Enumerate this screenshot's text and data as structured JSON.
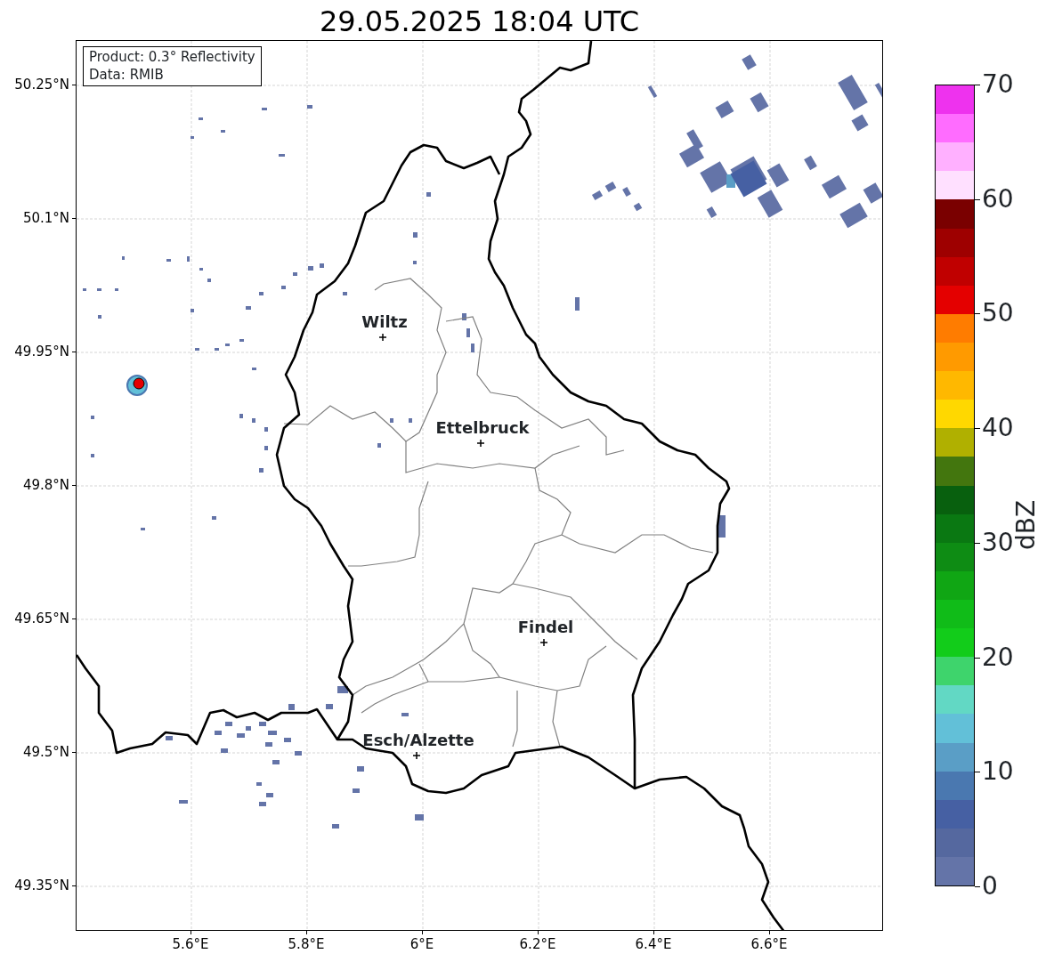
{
  "title": "29.05.2025 18:04 UTC",
  "info_box": [
    "Product: 0.3° Reflectivity",
    "Data: RMIB"
  ],
  "y_ticks": [
    "50.25°N",
    "50.1°N",
    "49.95°N",
    "49.8°N",
    "49.65°N",
    "49.5°N",
    "49.35°N"
  ],
  "x_ticks": [
    "5.6°E",
    "5.8°E",
    "6°E",
    "6.2°E",
    "6.4°E",
    "6.6°E"
  ],
  "cities": [
    {
      "name": "Wiltz"
    },
    {
      "name": "Ettelbruck"
    },
    {
      "name": "Findel"
    },
    {
      "name": "Esch/Alzette"
    }
  ],
  "colorbar": {
    "label": "dBZ",
    "ticks": [
      "70",
      "60",
      "50",
      "40",
      "30",
      "20",
      "10",
      "0"
    ],
    "steps": [
      {
        "color": "#ee32ee"
      },
      {
        "color": "#ff6cff"
      },
      {
        "color": "#ffb0ff"
      },
      {
        "color": "#ffe0ff"
      },
      {
        "color": "#7a0000"
      },
      {
        "color": "#9e0000"
      },
      {
        "color": "#c00000"
      },
      {
        "color": "#e40000"
      },
      {
        "color": "#ff7c00"
      },
      {
        "color": "#ff9a00"
      },
      {
        "color": "#ffb800"
      },
      {
        "color": "#ffd800"
      },
      {
        "color": "#b0b000"
      },
      {
        "color": "#43760e"
      },
      {
        "color": "#08600e"
      },
      {
        "color": "#0a7812"
      },
      {
        "color": "#0e8c14"
      },
      {
        "color": "#10a614"
      },
      {
        "color": "#10bc18"
      },
      {
        "color": "#12cc1a"
      },
      {
        "color": "#3ed46c"
      },
      {
        "color": "#62d8c4"
      },
      {
        "color": "#62c0d8"
      },
      {
        "color": "#5a9ec6"
      },
      {
        "color": "#4a78b0"
      },
      {
        "color": "#4660a3"
      },
      {
        "color": "#55689f"
      },
      {
        "color": "#6474a8"
      }
    ]
  }
}
